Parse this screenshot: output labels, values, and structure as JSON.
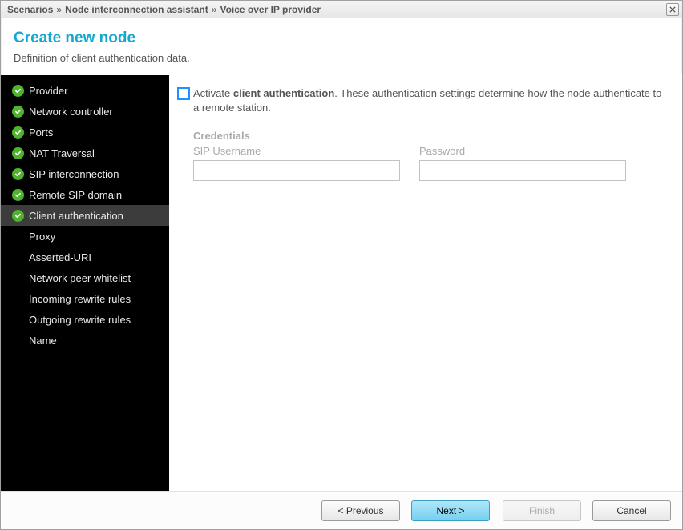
{
  "titlebar": {
    "crumbs": [
      "Scenarios",
      "Node interconnection assistant",
      "Voice over IP provider"
    ],
    "sep": "»"
  },
  "header": {
    "title": "Create new node",
    "subtitle": "Definition of client authentication data."
  },
  "sidebar": {
    "items": [
      {
        "label": "Provider",
        "done": true,
        "active": false
      },
      {
        "label": "Network controller",
        "done": true,
        "active": false
      },
      {
        "label": "Ports",
        "done": true,
        "active": false
      },
      {
        "label": "NAT Traversal",
        "done": true,
        "active": false
      },
      {
        "label": "SIP interconnection",
        "done": true,
        "active": false
      },
      {
        "label": "Remote SIP domain",
        "done": true,
        "active": false
      },
      {
        "label": "Client authentication",
        "done": true,
        "active": true
      },
      {
        "label": "Proxy",
        "done": false,
        "active": false
      },
      {
        "label": "Asserted-URI",
        "done": false,
        "active": false
      },
      {
        "label": "Network peer whitelist",
        "done": false,
        "active": false
      },
      {
        "label": "Incoming rewrite rules",
        "done": false,
        "active": false
      },
      {
        "label": "Outgoing rewrite rules",
        "done": false,
        "active": false
      },
      {
        "label": "Name",
        "done": false,
        "active": false
      }
    ]
  },
  "content": {
    "activate_prefix": "Activate ",
    "activate_bold": "client authentication",
    "activate_suffix": ". These authentication settings determine how the node authenticate to a remote station.",
    "activate_checked": false,
    "credentials_title": "Credentials",
    "username_label": "SIP Username",
    "username_value": "",
    "password_label": "Password",
    "password_value": ""
  },
  "footer": {
    "previous": "< Previous",
    "next": "Next >",
    "finish": "Finish",
    "cancel": "Cancel"
  }
}
